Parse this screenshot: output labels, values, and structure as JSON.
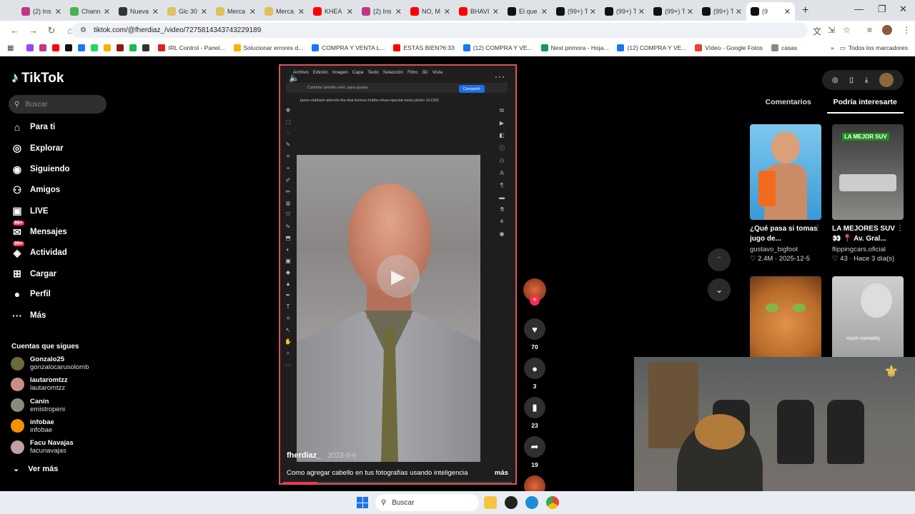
{
  "browser": {
    "tabs": [
      {
        "title": "(2) Ins",
        "color": "#c13584"
      },
      {
        "title": "Chann",
        "color": "#4caf50"
      },
      {
        "title": "Nueva",
        "color": "#333333"
      },
      {
        "title": "Glc 30",
        "color": "#e0c060"
      },
      {
        "title": "Merca",
        "color": "#e0c060"
      },
      {
        "title": "Merca",
        "color": "#e0c060"
      },
      {
        "title": "KHEA",
        "color": "#ff0000"
      },
      {
        "title": "(2) Ins",
        "color": "#c13584"
      },
      {
        "title": "NO, M",
        "color": "#ff0000"
      },
      {
        "title": "BHAVI",
        "color": "#ff0000"
      },
      {
        "title": "El que",
        "color": "#111111"
      },
      {
        "title": "(99+) T",
        "color": "#111111"
      },
      {
        "title": "(99+) T",
        "color": "#111111"
      },
      {
        "title": "(99+) T",
        "color": "#111111"
      },
      {
        "title": "(99+) T",
        "color": "#111111"
      },
      {
        "title": "(9",
        "color": "#111111"
      }
    ],
    "url": "tiktok.com/@fherdiaz_/video/7275814343743229189",
    "bookmarks": [
      {
        "label": "IRL Control - Panel...",
        "color": "#d22"
      },
      {
        "label": "Solucionar errores d...",
        "color": "#f4b400"
      },
      {
        "label": "COMPRA Y VENTA L...",
        "color": "#1877f2"
      },
      {
        "label": "ESTÁS BIEN?6:33",
        "color": "#ff0000"
      },
      {
        "label": "(12) COMPRA Y VE...",
        "color": "#1877f2"
      },
      {
        "label": "Next primora - Hoja...",
        "color": "#0f9d58"
      },
      {
        "label": "(12) COMPRA Y VE...",
        "color": "#1877f2"
      },
      {
        "label": "Vídeo - Google Fotos",
        "color": "#ea4335"
      },
      {
        "label": "casas",
        "color": "#888888"
      }
    ],
    "all_bookmarks": "Todos los marcadores"
  },
  "sidebar": {
    "brand": "TikTok",
    "search_placeholder": "Buscar",
    "menu": [
      {
        "label": "Para ti",
        "icon": "home-icon"
      },
      {
        "label": "Explorar",
        "icon": "compass-icon"
      },
      {
        "label": "Siguiendo",
        "icon": "following-icon"
      },
      {
        "label": "Amigos",
        "icon": "friends-icon"
      },
      {
        "label": "LIVE",
        "icon": "live-icon"
      },
      {
        "label": "Mensajes",
        "icon": "messages-icon",
        "badge": "99+"
      },
      {
        "label": "Actividad",
        "icon": "activity-icon",
        "badge": "99+"
      },
      {
        "label": "Cargar",
        "icon": "upload-icon"
      },
      {
        "label": "Perfil",
        "icon": "profile-icon"
      },
      {
        "label": "Más",
        "icon": "more-icon"
      }
    ],
    "following_title": "Cuentas que sigues",
    "accounts": [
      {
        "name": "Gonzalo25",
        "handle": "gonzalocarusolomb",
        "color": "#6a6a3a"
      },
      {
        "name": "lautaromtzz",
        "handle": "lautaromtzz",
        "color": "#c98f86"
      },
      {
        "name": "Canin",
        "handle": "emistropeni",
        "color": "#8a8a7a"
      },
      {
        "name": "infobae",
        "handle": "infobae",
        "color": "#f39200"
      },
      {
        "name": "Facu Navajas",
        "handle": "facunavajas",
        "color": "#c0a0a0"
      }
    ],
    "see_more": "Ver más"
  },
  "video": {
    "ps_menu": [
      "Archivo",
      "Edición",
      "Imagen",
      "Capa",
      "Texto",
      "Selección",
      "Filtro",
      "3D",
      "Vista"
    ],
    "ps_option": "Cambiar tamaño vent. para ajustar",
    "ps_share": "Compartir",
    "ps_file": "jason-statham-attends-the-fast-furious-hobbs-shaw-special-news-photo-161283",
    "author": "fherdiaz_",
    "date": "· 2023-9-6",
    "caption": "Como agregar cabello en tus fotografías usando inteligencia",
    "more": "más",
    "progress": 0.15
  },
  "actions": {
    "likes": "70",
    "comments": "3",
    "saves": "23",
    "shares": "19"
  },
  "right": {
    "tab_comments": "Comentarios",
    "tab_suggested": "Podría interesarte",
    "cards": [
      {
        "title": "¿Qué pasa si tomas jugo de...",
        "author": "gustavo_bigfoot",
        "stats": "♡ 2.4M · 2025-12-5"
      },
      {
        "title": "LA MEJORES SUV 👀 📍 Av. Gral...",
        "author": "flippingcars.oficial",
        "stats": "♡ 43 · Hace 3 día(s)",
        "overlay": "LA MEJOR SUV"
      },
      {
        "title": "",
        "author": "",
        "stats": ""
      },
      {
        "title": "",
        "author": "",
        "stats": "",
        "overlay": "much mentality"
      }
    ]
  },
  "taskbar": {
    "search": "Buscar"
  }
}
